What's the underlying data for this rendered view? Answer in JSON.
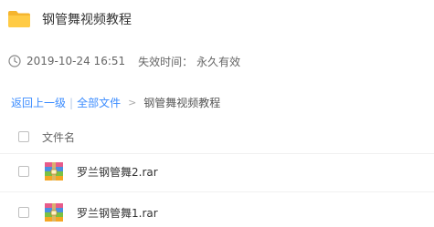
{
  "header": {
    "title": "钢管舞视频教程",
    "folder_icon": "folder-icon"
  },
  "meta": {
    "clock_icon": "clock-icon",
    "date": "2019-10-24 16:51",
    "expire_label": "失效时间：",
    "expire_value": "永久有效"
  },
  "breadcrumb": {
    "back": "返回上一级",
    "separator": "|",
    "all_files": "全部文件",
    "arrow": ">",
    "current": "钢管舞视频教程"
  },
  "table": {
    "column_name": "文件名",
    "rows": [
      {
        "name": "罗兰钢管舞2.rar",
        "icon": "rar-archive-icon"
      },
      {
        "name": "罗兰钢管舞1.rar",
        "icon": "rar-archive-icon"
      }
    ]
  },
  "colors": {
    "link": "#3b8cff",
    "folder": "#ffc83d"
  }
}
